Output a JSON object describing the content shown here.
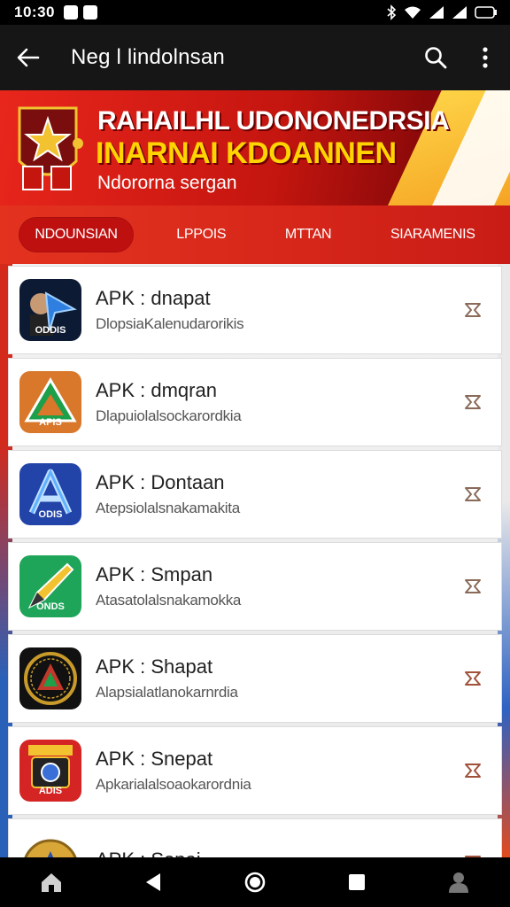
{
  "status_bar": {
    "time": "10:30"
  },
  "app_bar": {
    "title": "Neg l lindolnsan"
  },
  "banner": {
    "headline1": "RAHAILHL UDONONEDRSIA",
    "headline2": "INARNAI KDOANNEN",
    "subline": "Ndororna sergan"
  },
  "tabs": [
    {
      "label": "NDOUNSIAN",
      "active": true
    },
    {
      "label": "LPPOIS",
      "active": false
    },
    {
      "label": "MTTAN",
      "active": false
    },
    {
      "label": "SIARAMENIS",
      "active": false
    }
  ],
  "apps": [
    {
      "name": "APK : dnapat",
      "desc": "DlopsiaKalenudarorikis",
      "icon_label": "ODDIS",
      "icon_name": "arrow-portrait-app-icon",
      "colors": [
        "#0d1a33",
        "#2f7fe0"
      ]
    },
    {
      "name": "APK : dmqran",
      "desc": "Dlapuiolalsockarordkia",
      "icon_label": "APIS",
      "icon_name": "triangle-orange-app-icon",
      "colors": [
        "#d9772a",
        "#1e9f4a"
      ]
    },
    {
      "name": "APK : Dontaan",
      "desc": "Atepsiolalsnakamakita",
      "icon_label": "ODIS",
      "icon_name": "letter-a-blue-app-icon",
      "colors": [
        "#2243a8",
        "#5fb0ff"
      ]
    },
    {
      "name": "APK : Smpan",
      "desc": "Atasatolalsnakamokka",
      "icon_label": "ONDS",
      "icon_name": "pencil-green-app-icon",
      "colors": [
        "#1fa55a",
        "#f2c230"
      ]
    },
    {
      "name": "APK : Shapat",
      "desc": "Alapsialatlanokarnrdia",
      "icon_label": "",
      "icon_name": "badge-dark-app-icon",
      "colors": [
        "#111111",
        "#c89a2a"
      ]
    },
    {
      "name": "APK : Snepat",
      "desc": "Apkarialalsoaokarordnia",
      "icon_label": "ADIS",
      "icon_name": "camera-red-app-icon",
      "colors": [
        "#d42424",
        "#f2c230"
      ]
    },
    {
      "name": "APK : Sopai",
      "desc": "",
      "icon_label": "",
      "icon_name": "coin-gold-app-icon",
      "colors": [
        "#d8a738",
        "#2a4fa8"
      ]
    }
  ]
}
